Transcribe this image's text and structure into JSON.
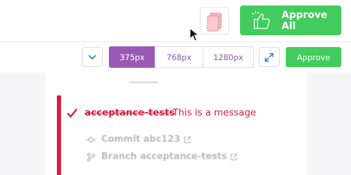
{
  "header": {
    "approve_all_label": "Approve All"
  },
  "toolbar": {
    "viewports": [
      "375px",
      "768px",
      "1280px"
    ],
    "approve_label": "Approve"
  },
  "test": {
    "name": "acceptance-tests",
    "message": "This is a message",
    "commit_label": "Commit abc123",
    "branch_label": "Branch acceptance-tests"
  },
  "colors": {
    "accent_green": "#42cc5e",
    "accent_purple": "#9b59b6",
    "fail_red": "#d81b3e"
  }
}
